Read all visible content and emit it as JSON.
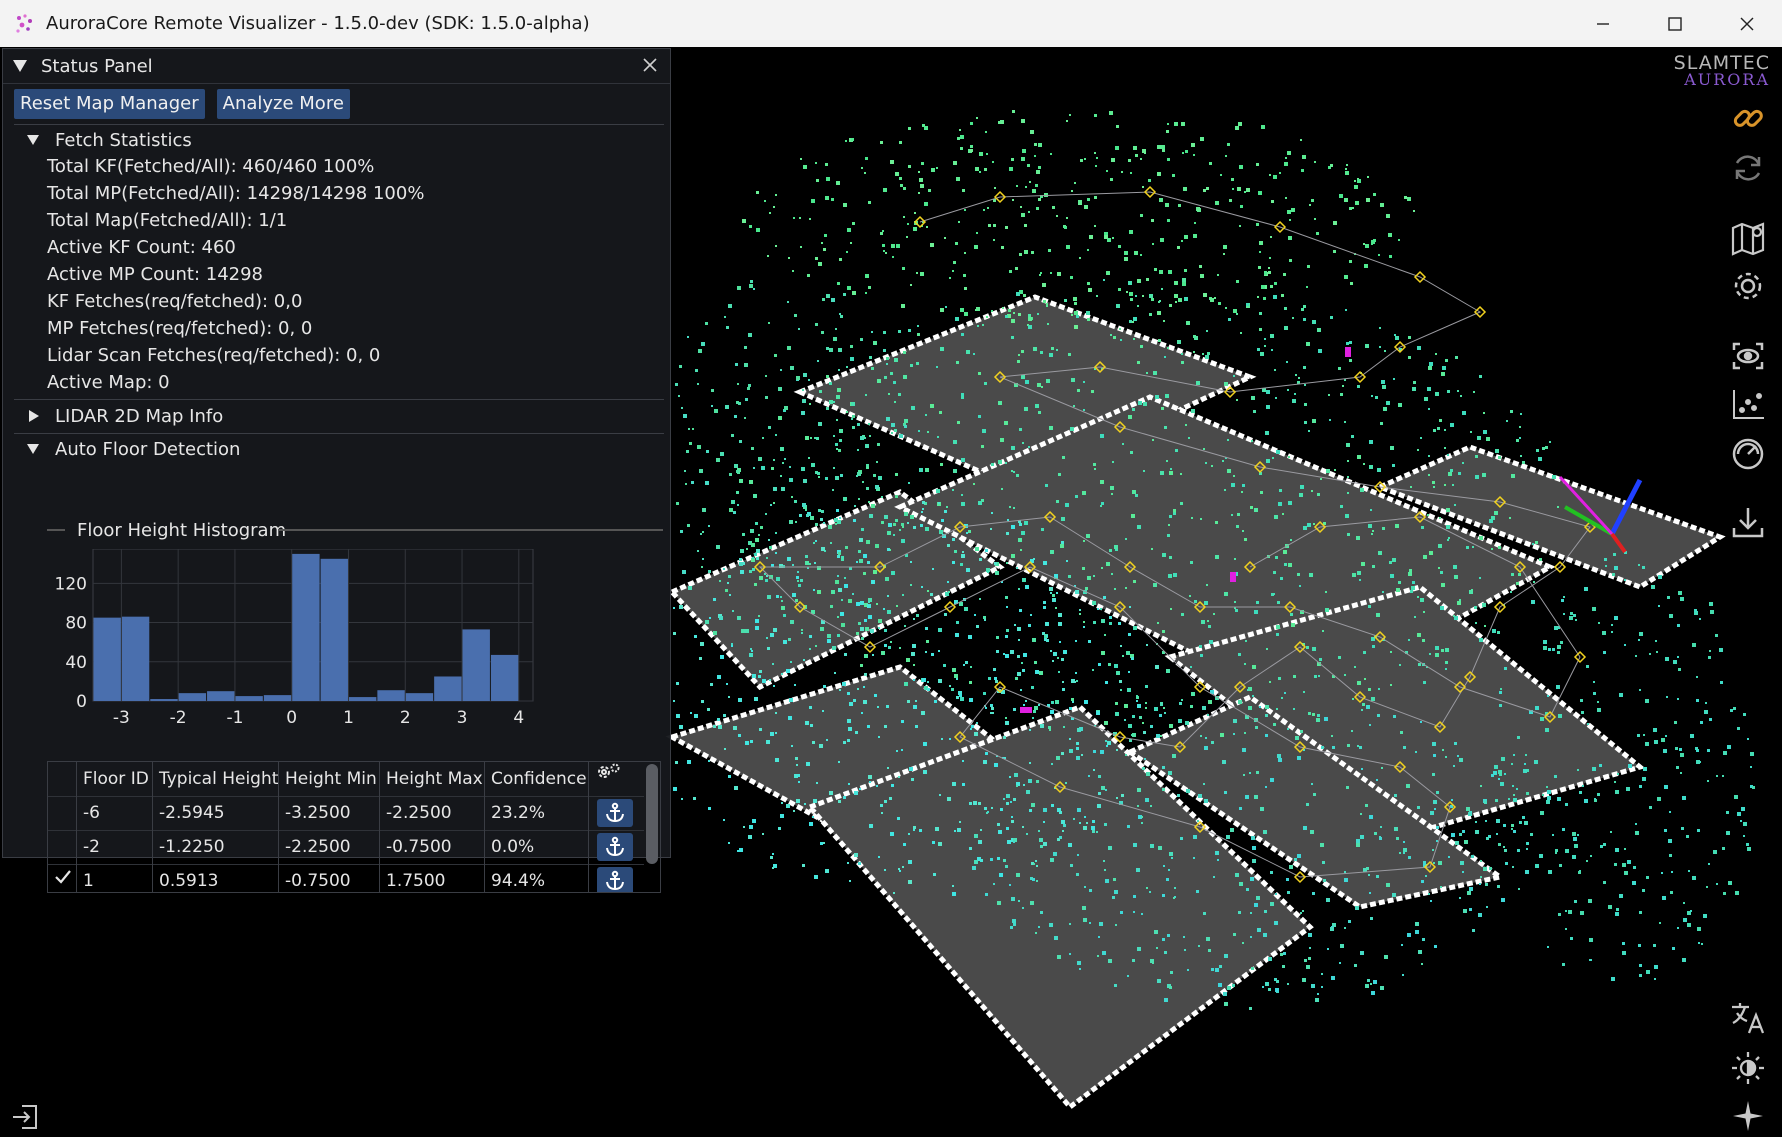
{
  "window": {
    "title": "AuroraCore Remote Visualizer - 1.5.0-dev (SDK: 1.5.0-alpha)",
    "minimize_icon": "minimize-icon",
    "maximize_icon": "maximize-icon",
    "close_icon": "close-icon"
  },
  "logo": {
    "line1": "SLAMTEC",
    "line2": "AURORA"
  },
  "status_panel": {
    "title": "Status Panel",
    "buttons": {
      "reset": "Reset Map Manager",
      "analyze": "Analyze More"
    },
    "fetch_statistics": {
      "label": "Fetch Statistics",
      "lines": [
        "Total KF(Fetched/All): 460/460 100%",
        "Total MP(Fetched/All): 14298/14298 100%",
        "Total Map(Fetched/All): 1/1",
        "Active KF Count: 460",
        "Active MP Count: 14298",
        "KF Fetches(req/fetched): 0,0",
        "MP Fetches(req/fetched): 0, 0",
        "Lidar Scan Fetches(req/fetched): 0, 0",
        "Active Map: 0"
      ]
    },
    "lidar_section": {
      "label": "LIDAR 2D Map Info",
      "collapsed": true
    },
    "auto_floor": {
      "label": "Auto Floor Detection",
      "histogram_title": "Floor Height Histogram"
    },
    "floor_table": {
      "headers": [
        "Floor ID",
        "Typical Height",
        "Height Min",
        "Height Max",
        "Confidence"
      ],
      "settings_icon": "gears-icon",
      "rows": [
        {
          "selected": false,
          "id": "-6",
          "typical": "-2.5945",
          "min": "-3.2500",
          "max": "-2.2500",
          "confidence": "23.2%"
        },
        {
          "selected": false,
          "id": "-2",
          "typical": "-1.2250",
          "min": "-2.2500",
          "max": "-0.7500",
          "confidence": "0.0%"
        },
        {
          "selected": true,
          "id": "1",
          "typical": "0.5913",
          "min": "-0.7500",
          "max": "1.7500",
          "confidence": "94.4%"
        }
      ],
      "row_action_icon": "anchor-icon"
    }
  },
  "chart_data": {
    "type": "bar",
    "title": "Floor Height Histogram",
    "x": [
      -3.25,
      -2.75,
      -2.25,
      -1.75,
      -1.25,
      -0.75,
      -0.25,
      0.25,
      0.75,
      1.25,
      1.75,
      2.25,
      2.75,
      3.25,
      3.75
    ],
    "bin_width": 0.5,
    "values": [
      85,
      86,
      2,
      8,
      10,
      5,
      6,
      150,
      145,
      4,
      11,
      8,
      25,
      73,
      47
    ],
    "xlim": [
      -3.5,
      4.25
    ],
    "ylim": [
      0,
      155
    ],
    "xticks": [
      -3,
      -2,
      -1,
      0,
      1,
      2,
      3,
      4
    ],
    "yticks": [
      0,
      40,
      80,
      120
    ],
    "grid": true,
    "bar_color": "#4a6fae"
  },
  "toolbar_icons": [
    "link-icon",
    "refresh-icon",
    "map-icon",
    "settings-icon",
    "camera-view-icon",
    "scatter-chart-icon",
    "gauge-icon",
    "download-icon",
    "translate-icon",
    "brightness-icon",
    "sparkle-icon"
  ],
  "colors": {
    "accent": "#2b4a79",
    "link_icon": "#d9942a",
    "point_cloud_a": "#3fe0a0",
    "point_cloud_b": "#3ee0e6",
    "trajectory": "#f2d21f"
  }
}
